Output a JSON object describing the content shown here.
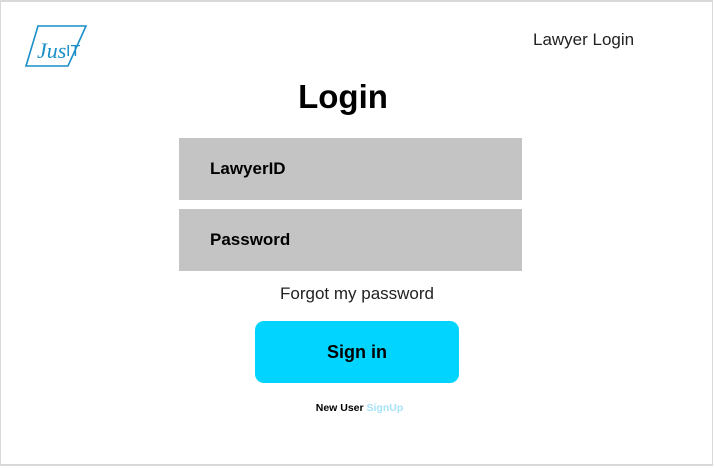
{
  "logo": {
    "text": "JusIT",
    "color": "#1a8fc7"
  },
  "header": {
    "lawyer_login_label": "Lawyer Login"
  },
  "main": {
    "title": "Login",
    "lawyer_id_placeholder": "LawyerID",
    "password_placeholder": "Password",
    "forgot_label": "Forgot my password",
    "signin_label": "Sign in",
    "new_user_label": "New User",
    "signup_label": "SignUp"
  },
  "colors": {
    "field_bg": "#c4c4c4",
    "signin_bg": "#00d4ff",
    "signup_link": "#a7e3f8"
  }
}
